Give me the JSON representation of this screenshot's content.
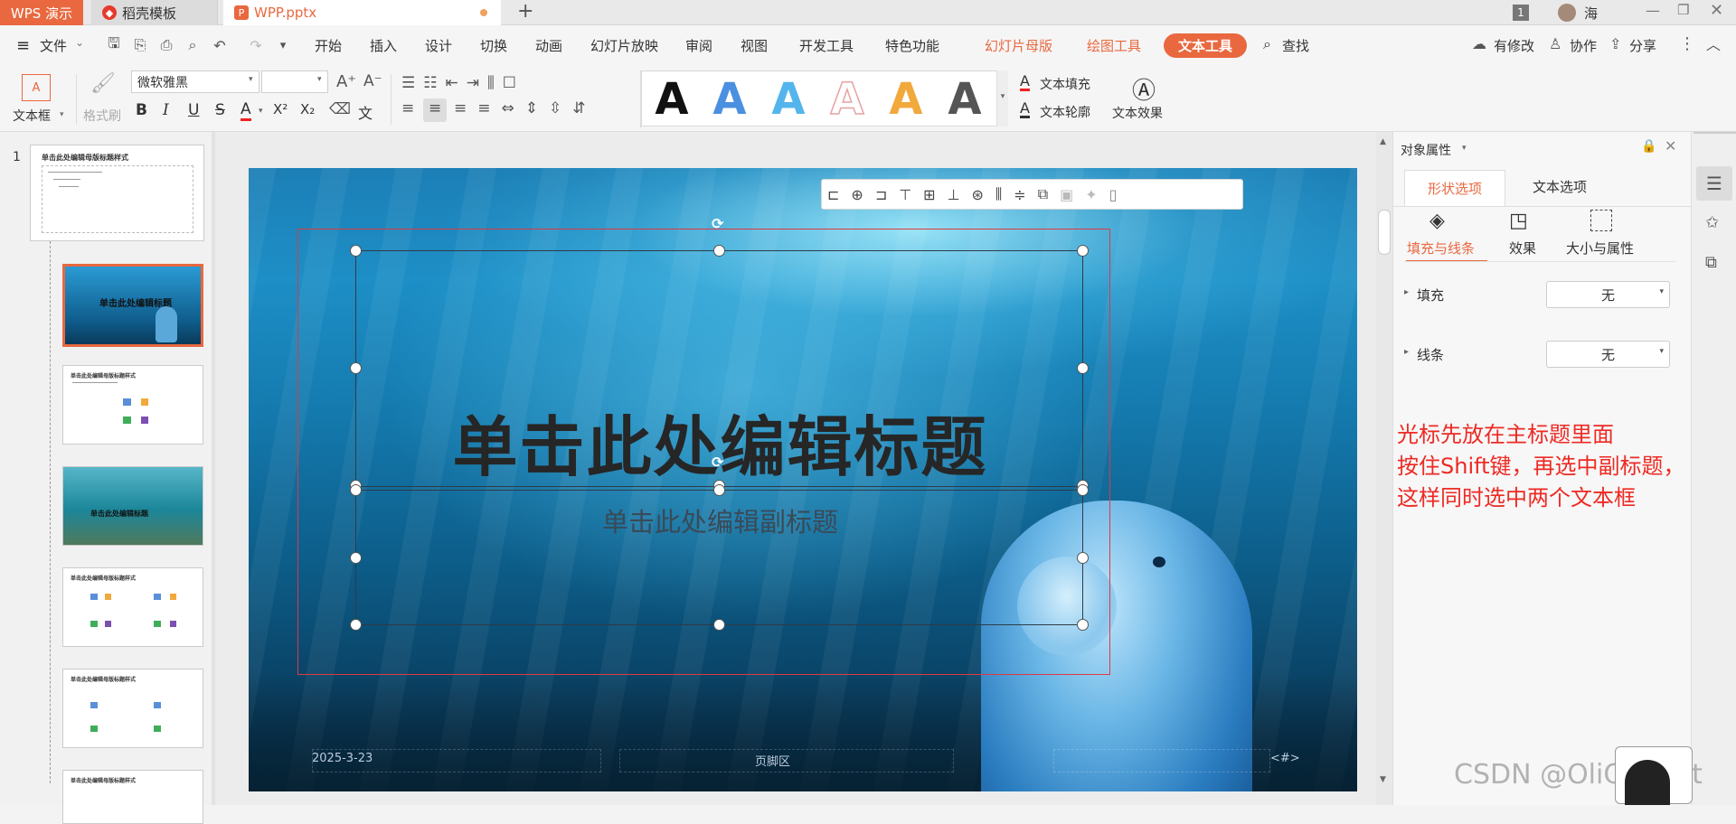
{
  "tabs": {
    "app": "WPS 演示",
    "docer": "稻壳模板",
    "file": "WPP.pptx",
    "user": "海",
    "page_badge": "1"
  },
  "menu": {
    "file": "文件",
    "items": [
      "开始",
      "插入",
      "设计",
      "切换",
      "动画",
      "幻灯片放映",
      "审阅",
      "视图",
      "开发工具",
      "特色功能"
    ],
    "context": [
      "幻灯片母版",
      "绘图工具"
    ],
    "active_context": "文本工具",
    "search": "查找",
    "modified": "有修改",
    "collab": "协作",
    "share": "分享"
  },
  "ribbon": {
    "textbox": "文本框",
    "format_painter": "格式刷",
    "font": "微软雅黑",
    "font_size": "",
    "text_fill": "文本填充",
    "text_outline": "文本轮廓",
    "text_effect": "文本效果",
    "style_glyph": "A",
    "style_colors": [
      "#111111",
      "#4a8fe0",
      "#54b5ec",
      "#e8a2a2",
      "#f1a93c",
      "#555555"
    ],
    "bold": "B",
    "italic": "I",
    "underline": "U",
    "strike": "S",
    "color_a": "A",
    "sup": "X²",
    "sub": "X₂",
    "pinyin": "文"
  },
  "thumbnails": {
    "master_number": "1",
    "master_title": "单击此处编辑母版标题样式",
    "layout_title": "单击此处编辑标题",
    "layout_title_2": "单击此处编辑副标题",
    "layout_label": "单击此处编辑母版标题样式"
  },
  "slide": {
    "title": "单击此处编辑标题",
    "subtitle": "单击此处编辑副标题",
    "date": "2025-3-23",
    "footer": "页脚区",
    "page": "<#>"
  },
  "panel": {
    "title": "对象属性",
    "tabs": [
      "形状选项",
      "文本选项"
    ],
    "subtabs": [
      "填充与线条",
      "效果",
      "大小与属性"
    ],
    "fill_label": "填充",
    "fill_value": "无",
    "line_label": "线条",
    "line_value": "无"
  },
  "annotation": {
    "line1": "光标先放在主标题里面",
    "line2": "按住Shift键，再选中副标题，",
    "line3": "这样同时选中两个文本框"
  },
  "watermark": "CSDN @OliCorrect"
}
